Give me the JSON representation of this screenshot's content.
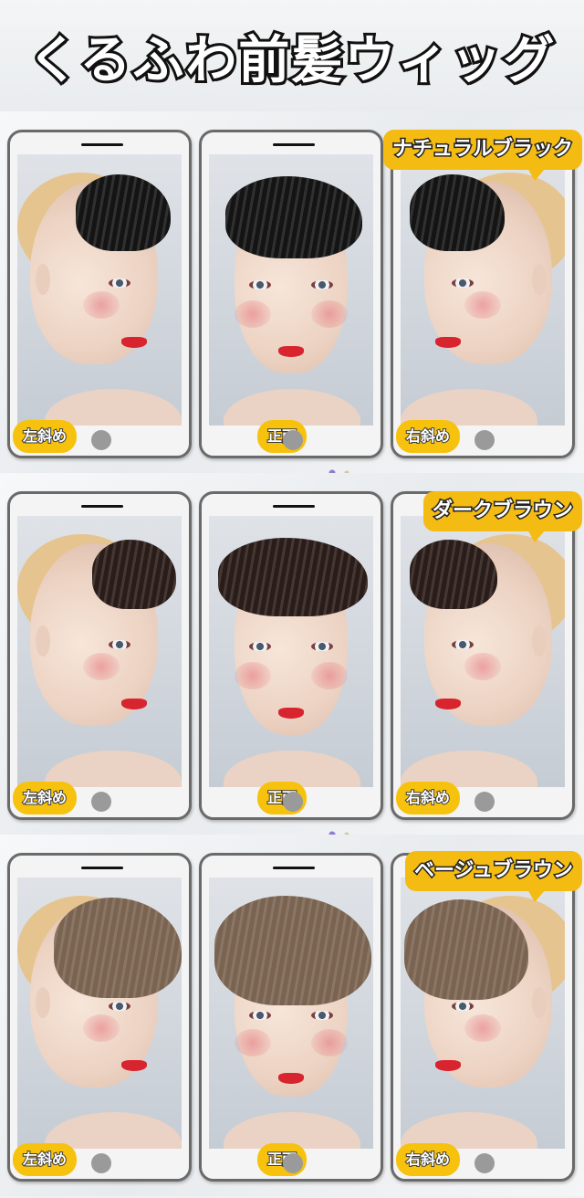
{
  "title": "くるふわ前髪ウィッグ",
  "badges": {
    "left": "左斜め",
    "front": "正面",
    "right": "右斜め"
  },
  "rows": [
    {
      "color_label": "ナチュラルブラック",
      "hair_color": "#141414"
    },
    {
      "color_label": "ダークブラウン",
      "hair_color": "#2a1c18"
    },
    {
      "color_label": "ベージュブラウン",
      "hair_color": "#7a6350"
    }
  ],
  "colors": {
    "badge": "#f7c20d",
    "label_bg": "#f4bb12",
    "phone_border": "#6a6a6a"
  }
}
